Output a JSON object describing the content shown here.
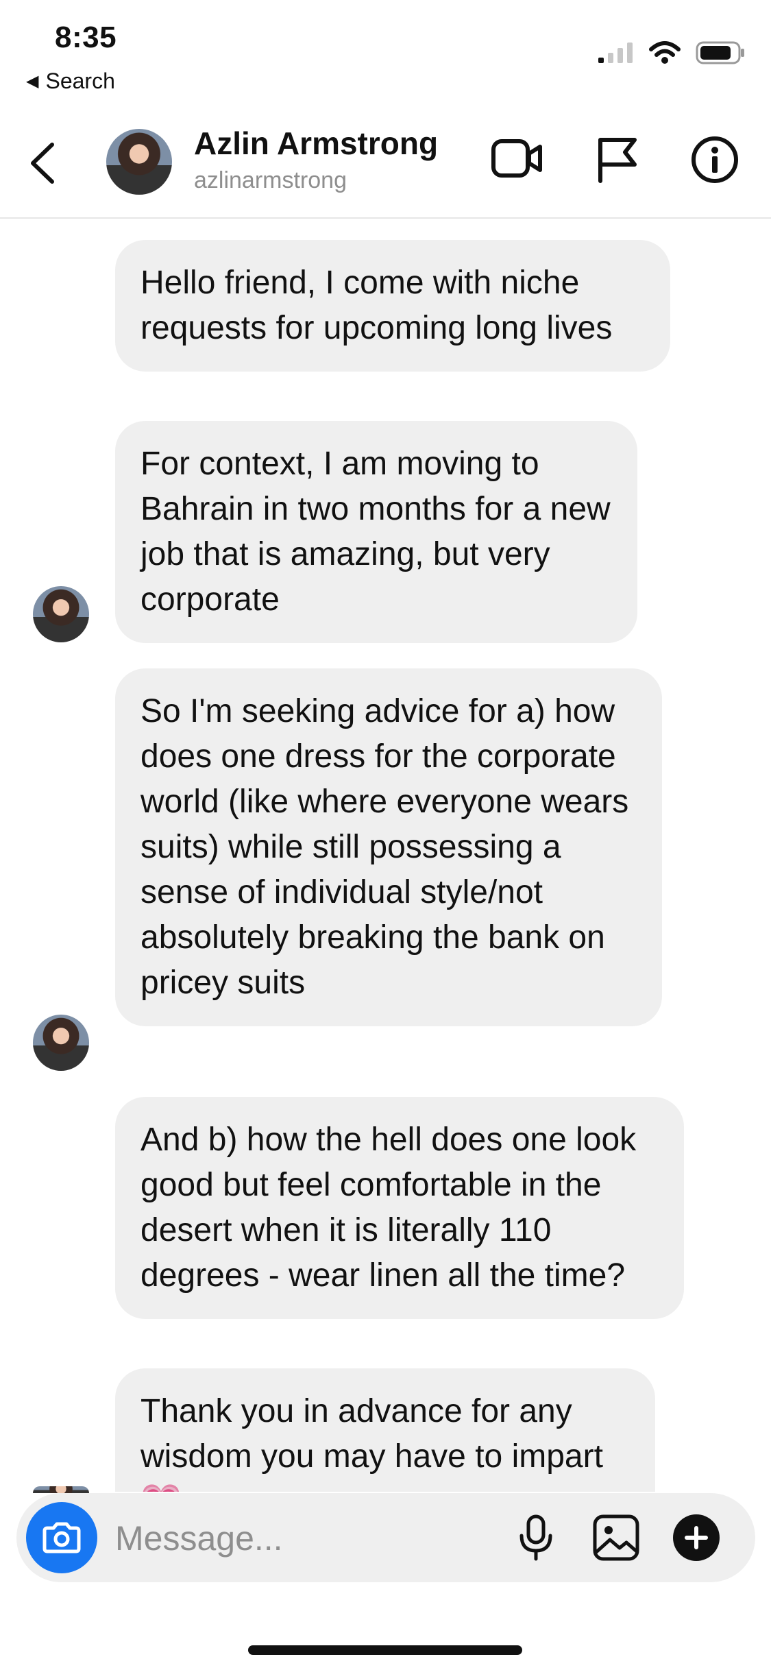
{
  "status_bar": {
    "time": "8:35",
    "back_label": "Search",
    "back_glyph": "◀"
  },
  "header": {
    "name": "Azlin Armstrong",
    "username": "azlinarmstrong",
    "icons": [
      "back-chevron-icon",
      "video-camera-icon",
      "flag-icon",
      "info-icon"
    ]
  },
  "messages": [
    {
      "text": "Hello friend, I come with niche requests for upcoming long lives"
    },
    {
      "text": "For context, I am moving to Bahrain in two months for a new job that is amazing, but very corporate"
    },
    {
      "text": "So I'm seeking advice for a) how does one dress for the corporate world (like where everyone wears suits) while still possessing a sense of individual style/not absolutely breaking the bank on pricey suits"
    },
    {
      "text": "And b) how the hell does one look good but feel comfortable in the desert when it is literally 110 degrees - wear linen all the time?"
    },
    {
      "text": "Thank you in advance for any wisdom you may have to impart 💗"
    }
  ],
  "composer": {
    "placeholder": "Message...",
    "icons": [
      "camera-icon",
      "microphone-icon",
      "gallery-icon",
      "plus-icon"
    ]
  },
  "colors": {
    "accent_blue": "#1877f2",
    "bubble_bg": "#efefef",
    "secondary_text": "#8e8e8e"
  }
}
